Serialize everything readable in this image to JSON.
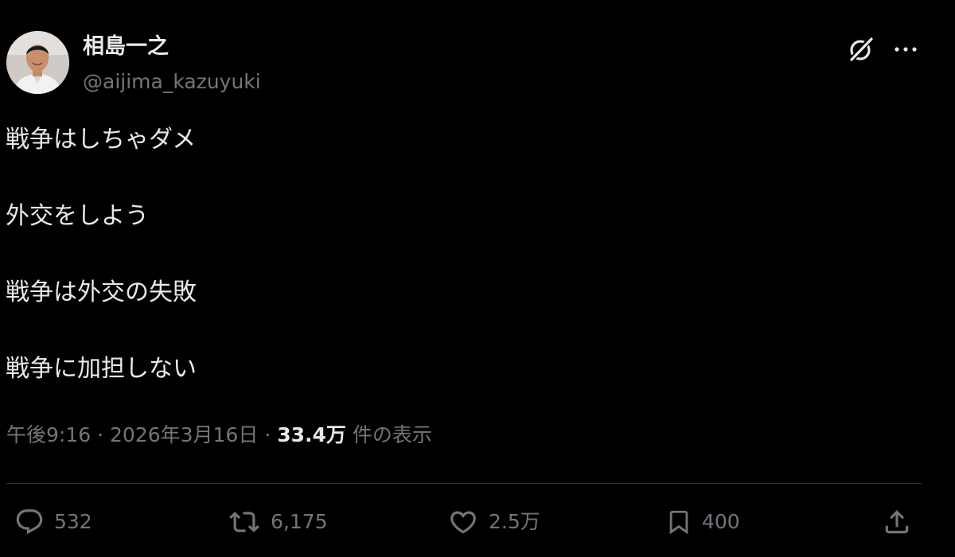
{
  "author": {
    "name": "相島一之",
    "handle": "@aijima_kazuyuki"
  },
  "header_icons": {
    "grok": "grok-icon",
    "more": "more-icon"
  },
  "tweet": {
    "lines": [
      "戦争はしちゃダメ",
      "外交をしよう",
      "戦争は外交の失敗",
      "戦争に加担しない"
    ]
  },
  "meta": {
    "time": "午後9:16",
    "separator": "·",
    "date": "2026年3月16日",
    "views_count": "33.4万",
    "views_label": "件の表示"
  },
  "actions": {
    "reply": {
      "icon": "reply-icon",
      "count": "532"
    },
    "repost": {
      "icon": "repost-icon",
      "count": "6,175"
    },
    "like": {
      "icon": "heart-icon",
      "count": "2.5万"
    },
    "bookmark": {
      "icon": "bookmark-icon",
      "count": "400"
    },
    "share": {
      "icon": "share-icon"
    }
  },
  "colors": {
    "background": "#000000",
    "primary_text": "#e7e9ea",
    "secondary_text": "#71767b",
    "divider": "#2f3336"
  }
}
